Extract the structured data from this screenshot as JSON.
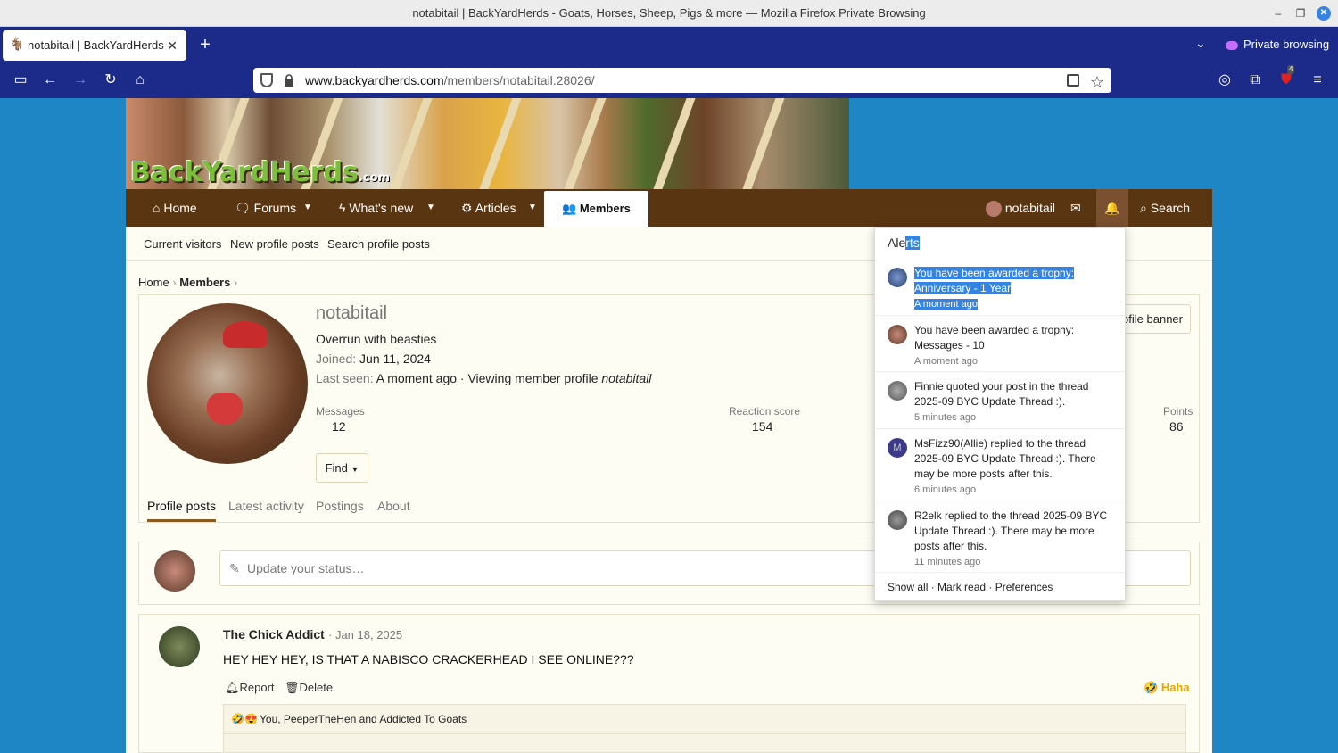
{
  "window": {
    "title": "notabitail | BackYardHerds - Goats, Horses, Sheep, Pigs & more — Mozilla Firefox Private Browsing"
  },
  "browser": {
    "tab_title": "notabitail | BackYardHerds ·",
    "url_host": "www.backyardherds.com",
    "url_path": "/members/notabitail.28026/",
    "private_label": "Private browsing",
    "ublock_count": "4"
  },
  "site": {
    "logo": "BackYardHerds",
    "logo_suffix": ".com"
  },
  "nav": {
    "home": "Home",
    "forums": "Forums",
    "whats_new": "What's new",
    "articles": "Articles",
    "members": "Members",
    "user": "notabitail",
    "search": "Search"
  },
  "subnav": {
    "current_visitors": "Current visitors",
    "new_profile_posts": "New profile posts",
    "search_profile_posts": "Search profile posts"
  },
  "breadcrumb": {
    "home": "Home",
    "members": "Members"
  },
  "profile": {
    "username": "notabitail",
    "title": "Overrun with beasties",
    "joined_label": "Joined:",
    "joined": "Jun 11, 2024",
    "last_seen_label": "Last seen:",
    "last_seen": "A moment ago · Viewing member profile",
    "last_seen_em": "notabitail",
    "messages_label": "Messages",
    "messages": "12",
    "reaction_label": "Reaction score",
    "reaction": "154",
    "points_label": "Points",
    "points": "86",
    "find": "Find",
    "banner_btn": "ofile banner"
  },
  "tabs": [
    "Profile posts",
    "Latest activity",
    "Postings",
    "About"
  ],
  "status": {
    "placeholder": "Update your status…"
  },
  "post": {
    "author": "The Chick Addict",
    "date": "· Jan 18, 2025",
    "text": "HEY HEY HEY, IS THAT A NABISCO CRACKERHEAD I SEE ONLINE???",
    "report": "Report",
    "delete": "Delete",
    "reaction": "Haha",
    "reactions_text": "You, PeeperTheHen and Addicted To Goats"
  },
  "alerts": {
    "title_a": "Ale",
    "title_b": "rts",
    "items": [
      {
        "line1": "You have been awarded a trophy:",
        "line2": "Anniversary - 1 Year",
        "time": "A moment ago"
      },
      {
        "line1": "You have been awarded a trophy:",
        "line2": "Messages - 10",
        "time": "A moment ago"
      },
      {
        "line1": "Finnie quoted your post in the thread",
        "line2": "2025-09 BYC Update Thread :).",
        "time": "5 minutes ago"
      },
      {
        "line1": "MsFizz90(Allie) replied to the thread",
        "line2": "2025-09 BYC Update Thread :). There",
        "line3": "may be more posts after this.",
        "time": "6 minutes ago",
        "initial": "M"
      },
      {
        "line1": "R2elk replied to the thread 2025-09 BYC",
        "line2": "Update Thread :). There may be more",
        "line3": "posts after this.",
        "time": "11 minutes ago"
      }
    ],
    "footer": "Show all · Mark read · Preferences"
  }
}
